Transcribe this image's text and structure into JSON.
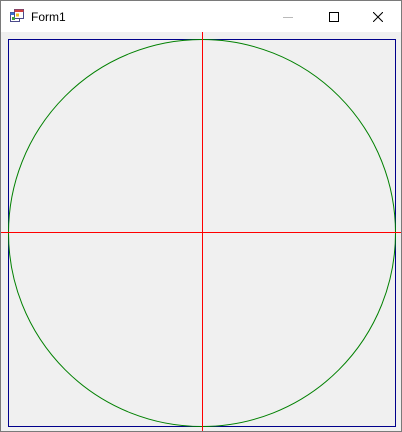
{
  "window": {
    "title": "Form1"
  },
  "title_bar": {
    "app_icon": "windows-form-icon",
    "minimize_icon": "minimize-icon",
    "maximize_icon": "maximize-icon",
    "close_icon": "close-icon"
  },
  "drawing": {
    "colors": {
      "border": "#00008b",
      "circle": "#008000",
      "axes": "#ff0000",
      "background": "#f0f0f0"
    }
  }
}
